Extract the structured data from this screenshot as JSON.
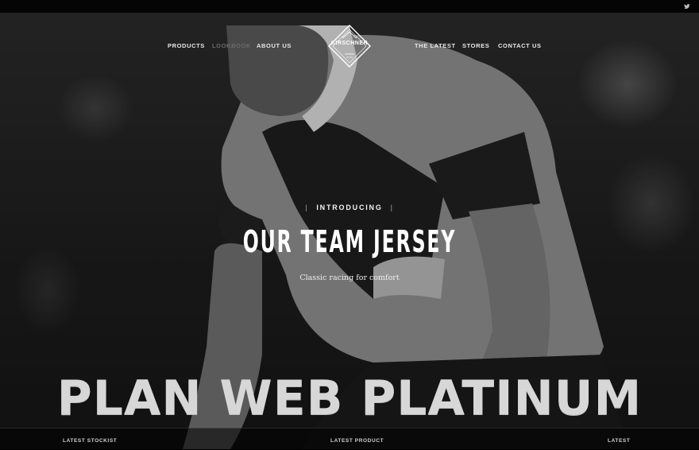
{
  "nav": {
    "left": [
      "PRODUCTS",
      "LOOKBOOK",
      "ABOUT US"
    ],
    "right": [
      "THE LATEST",
      "STORES",
      "CONTACT US"
    ]
  },
  "logo": {
    "text": "KIRSCHNER"
  },
  "icons": {
    "social": "twitter-icon"
  },
  "hero": {
    "introducing": "INTRODUCING",
    "headline": "OUR TEAM JERSEY",
    "tagline": "Classic racing for comfort"
  },
  "watermark": "PLAN WEB PLATINUM",
  "footer": {
    "col1": "LATEST STOCKIST",
    "col2": "LATEST PRODUCT",
    "col3": "LATEST"
  },
  "colors": {
    "accent": "#ffffff",
    "dim_nav": "#6b6b6b",
    "watermark": "#d7d7d7"
  }
}
